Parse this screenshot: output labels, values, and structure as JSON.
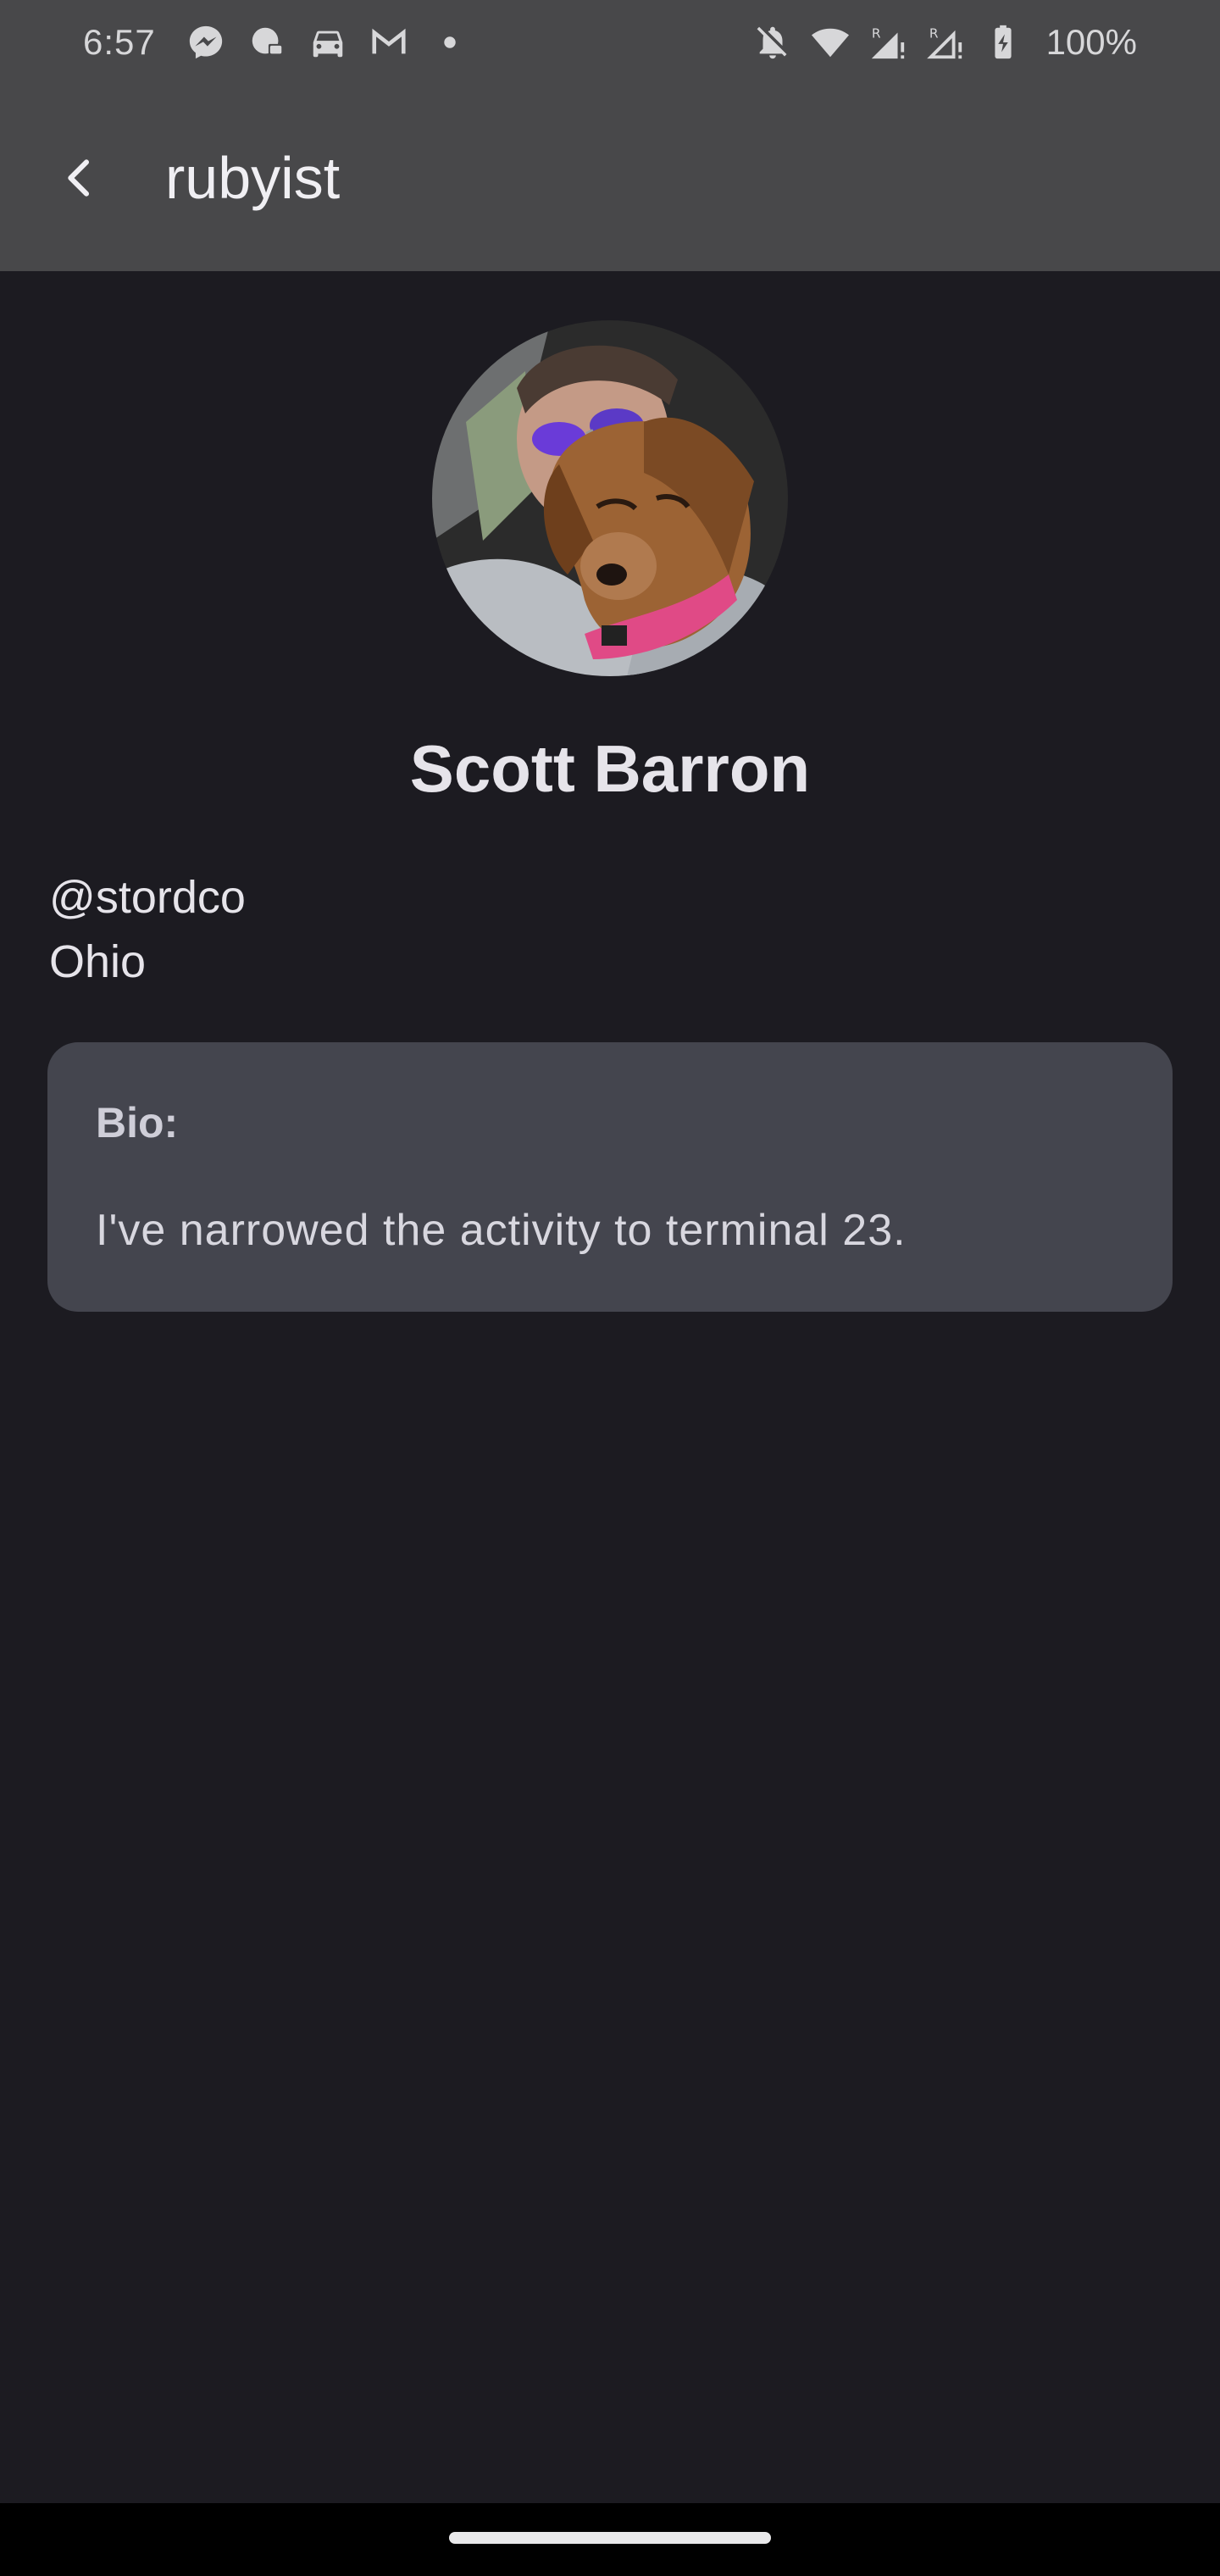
{
  "status_bar": {
    "time": "6:57",
    "battery": "100%",
    "left_icons": [
      "messenger-icon",
      "chat-bubble-icon",
      "car-icon",
      "gmail-icon",
      "dot-icon"
    ],
    "right_icons": [
      "notifications-off-icon",
      "wifi-icon",
      "signal-r-icon",
      "signal-r-icon",
      "battery-charging-icon"
    ]
  },
  "app_bar": {
    "title": "rubyist",
    "back_icon": "back-arrow-icon"
  },
  "profile": {
    "name": "Scott Barron",
    "handle": "@stordco",
    "location": "Ohio",
    "avatar_icon": "avatar-photo"
  },
  "bio": {
    "label": "Bio:",
    "text": "I've narrowed the activity to terminal 23."
  },
  "colors": {
    "background": "#1c1b21",
    "app_bar": "#48484a",
    "card": "#44454e",
    "text": "#e6e4ea"
  }
}
